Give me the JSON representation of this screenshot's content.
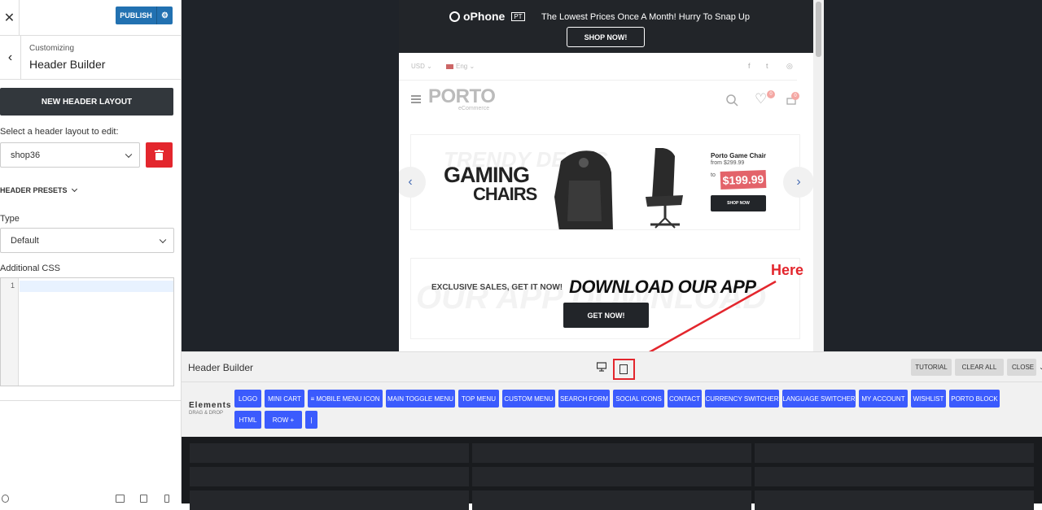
{
  "customizer": {
    "publish_label": "PUBLISH",
    "breadcrumb_sub": "Customizing",
    "breadcrumb_title": "Header Builder",
    "new_layout_label": "NEW HEADER LAYOUT",
    "select_layout_label": "Select a header layout to edit:",
    "layout_value": "shop36",
    "presets_label": "HEADER PRESETS",
    "type_label": "Type",
    "type_value": "Default",
    "css_label": "Additional CSS",
    "css_line_number": "1"
  },
  "preview": {
    "brand": "oPhone",
    "brand_tag": "PT",
    "promo_text": "The Lowest Prices Once A Month! Hurry To Snap Up",
    "shop_now": "SHOP NOW!",
    "currency": "USD",
    "language": "Eng",
    "logo": "PORTO",
    "logo_sub": "eCommerce",
    "wishlist_count": "0",
    "cart_count": "0",
    "slide_bg_text": "TRENDY DEALS",
    "slide_line1": "GAMING",
    "slide_line2": "CHAIRS",
    "product_name": "Porto Game Chair",
    "product_from": "from $299.99",
    "product_to": "to",
    "product_price": "$199.99",
    "product_btn": "SHOP NOW",
    "app_bg_text": "OUR APP DOWNLOAD",
    "exclusive": "EXCLUSIVE SALES, GET IT NOW!",
    "download": "DOWNLOAD OUR APP",
    "get_now": "GET NOW!"
  },
  "annotation": {
    "text": "Here",
    "color": "#e3262d"
  },
  "builder": {
    "title": "Header Builder",
    "tutorial": "TUTORIAL",
    "clear_all": "CLEAR ALL",
    "close": "CLOSE",
    "elements_title": "Elements",
    "elements_sub": "DRAG & DROP",
    "chips": [
      "LOGO",
      "MINI CART",
      "≡ MOBILE MENU ICON",
      "MAIN TOGGLE MENU",
      "TOP MENU",
      "CUSTOM MENU",
      "SEARCH FORM",
      "SOCIAL ICONS",
      "CONTACT",
      "CURRENCY SWITCHER",
      "LANGUAGE SWITCHER",
      "MY ACCOUNT",
      "WISHLIST",
      "PORTO BLOCK",
      "HTML",
      "ROW +",
      "|"
    ],
    "accent": "#3b5bfd"
  }
}
